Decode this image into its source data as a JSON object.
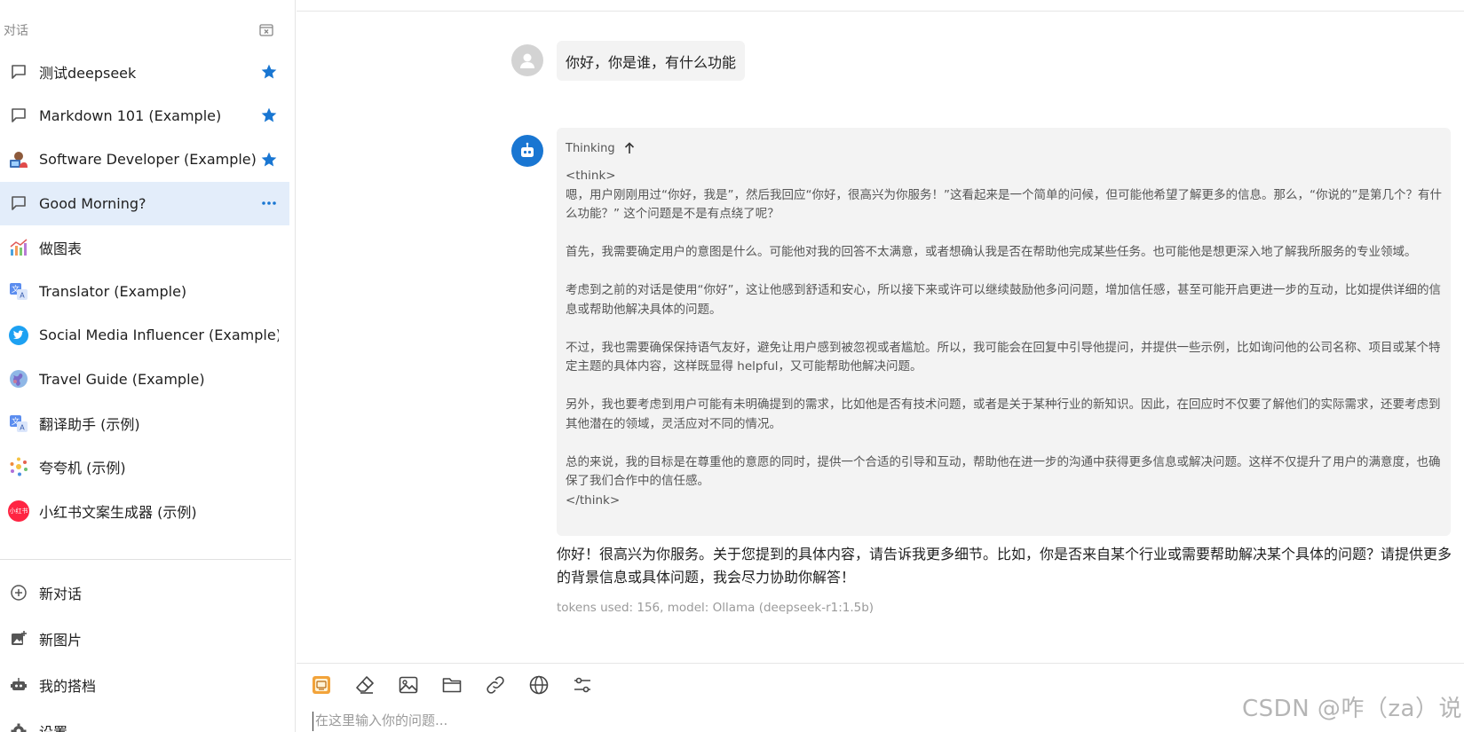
{
  "sidebar": {
    "title": "对话",
    "conversations": [
      {
        "label": "测试deepseek",
        "icon": "chat-bubble-icon",
        "trail": "star"
      },
      {
        "label": "Markdown 101 (Example)",
        "icon": "chat-bubble-icon",
        "trail": "star"
      },
      {
        "label": "Software Developer (Example)",
        "icon": "developer-avatar-icon",
        "trail": "star"
      },
      {
        "label": "Good Morning?",
        "icon": "chat-bubble-icon",
        "trail": "more"
      },
      {
        "label": "做图表",
        "icon": "chart-icon",
        "trail": ""
      },
      {
        "label": "Translator (Example)",
        "icon": "translate-icon",
        "trail": ""
      },
      {
        "label": "Social Media Influencer (Example)",
        "icon": "twitter-icon",
        "trail": ""
      },
      {
        "label": "Travel Guide (Example)",
        "icon": "globe-icon",
        "trail": ""
      },
      {
        "label": "翻译助手 (示例)",
        "icon": "translate-icon",
        "trail": ""
      },
      {
        "label": "夸夸机 (示例)",
        "icon": "sparkle-icon",
        "trail": ""
      },
      {
        "label": "小红书文案生成器 (示例)",
        "icon": "xiaohongshu-icon",
        "trail": ""
      }
    ],
    "badge_text": "小红书",
    "actions": [
      {
        "label": "新对话",
        "icon": "add-circle-icon"
      },
      {
        "label": "新图片",
        "icon": "add-image-icon"
      },
      {
        "label": "我的搭档",
        "icon": "robot-icon"
      },
      {
        "label": "设置",
        "icon": "gear-icon"
      }
    ]
  },
  "chat": {
    "user_message": "你好，你是谁，有什么功能",
    "thinking_label": "Thinking",
    "thinking_text": "<think>\n嗯，用户刚刚用过“你好，我是”，然后我回应“你好，很高兴为你服务！”这看起来是一个简单的问候，但可能他希望了解更多的信息。那么，“你说的”是第几个？有什么功能？” 这个问题是不是有点绕了呢？\n\n首先，我需要确定用户的意图是什么。可能他对我的回答不太满意，或者想确认我是否在帮助他完成某些任务。也可能他是想更深入地了解我所服务的专业领域。\n\n考虑到之前的对话是使用“你好”，这让他感到舒适和安心，所以接下来或许可以继续鼓励他多问问题，增加信任感，甚至可能开启更进一步的互动，比如提供详细的信息或帮助他解决具体的问题。\n\n不过，我也需要确保保持语气友好，避免让用户感到被忽视或者尴尬。所以，我可能会在回复中引导他提问，并提供一些示例，比如询问他的公司名称、项目或某个特定主题的具体内容，这样既显得 helpful，又可能帮助他解决问题。\n\n另外，我也要考虑到用户可能有未明确提到的需求，比如他是否有技术问题，或者是关于某种行业的新知识。因此，在回应时不仅要了解他们的实际需求，还要考虑到其他潜在的领域，灵活应对不同的情况。\n\n总的来说，我的目标是在尊重他的意愿的同时，提供一个合适的引导和互动，帮助他在进一步的沟通中获得更多信息或解决问题。这样不仅提升了用户的满意度，也确保了我们合作中的信任感。\n</think>",
    "answer": "你好！很高兴为你服务。关于您提到的具体内容，请告诉我更多细节。比如，你是否来自某个行业或需要帮助解决某个具体的问题？请提供更多的背景信息或具体问题，我会尽力协助你解答！",
    "meta": "tokens used: 156, model: Ollama (deepseek-r1:1.5b)"
  },
  "input": {
    "placeholder": "在这里输入你的问题..."
  },
  "toolbar": {
    "tools": [
      "model-picker-icon",
      "eraser-icon",
      "image-icon",
      "folder-icon",
      "link-icon",
      "globe-icon",
      "settings-sliders-icon"
    ]
  },
  "watermark": "CSDN @咋（za）说",
  "colors": {
    "accent": "#1976d2",
    "active_bg": "#e3edfa",
    "bubble_bg": "#f3f3f3"
  }
}
